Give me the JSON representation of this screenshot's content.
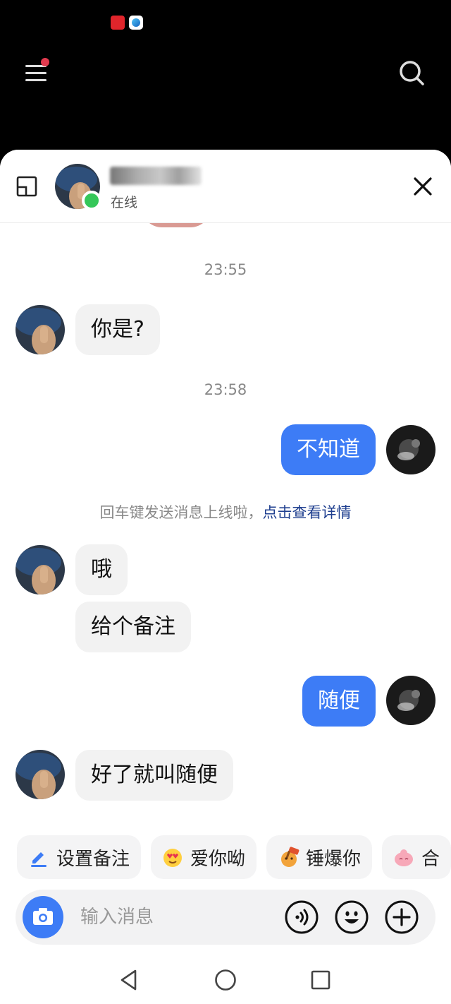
{
  "header": {
    "status": "在线"
  },
  "messages": {
    "time1": "23:55",
    "in1": "你是?",
    "time2": "23:58",
    "out1": "不知道",
    "notice_text": "回车键发送消息上线啦，",
    "notice_link": "点击查看详情",
    "in2": "哦",
    "in3": "给个备注",
    "out2": "随便",
    "in4": "好了就叫随便"
  },
  "quick_actions": [
    {
      "label": "设置备注",
      "icon": "pencil-icon"
    },
    {
      "label": "爱你呦",
      "icon": "heart-eyes-emoji-icon"
    },
    {
      "label": "锤爆你",
      "icon": "hammer-emoji-icon"
    },
    {
      "label": "合",
      "icon": "pink-blob-emoji-icon"
    }
  ],
  "input": {
    "placeholder": "输入消息"
  },
  "colors": {
    "accent": "#3d7cf6",
    "online": "#35c759",
    "badge": "#e23a4e",
    "link": "#1f3f8f"
  }
}
